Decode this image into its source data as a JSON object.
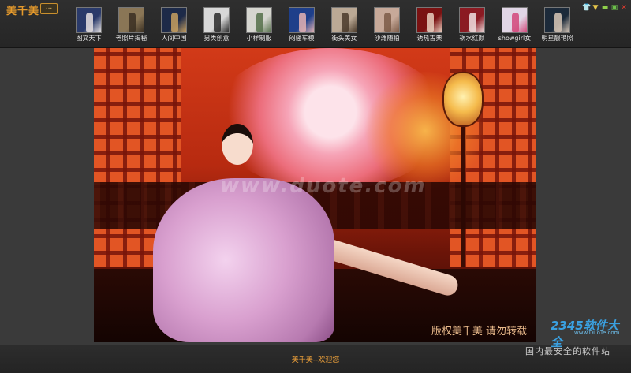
{
  "app": {
    "title": "美千美",
    "menu_label": "..."
  },
  "thumbnails": [
    {
      "label": "图文天下",
      "colors": [
        "#2a3a6a",
        "#e7e2e2"
      ]
    },
    {
      "label": "老照片揭秘",
      "colors": [
        "#8a7656",
        "#3a2f22"
      ]
    },
    {
      "label": "人间中国",
      "colors": [
        "#1d2a48",
        "#c8a060"
      ]
    },
    {
      "label": "另类创意",
      "colors": [
        "#d8d8d8",
        "#2a2a2a"
      ]
    },
    {
      "label": "小样制服",
      "colors": [
        "#d6d6d0",
        "#55704a"
      ]
    },
    {
      "label": "闷骚车模",
      "colors": [
        "#1e3f8a",
        "#e5b3b3"
      ]
    },
    {
      "label": "街头美女",
      "colors": [
        "#bba995",
        "#4a3a2a"
      ]
    },
    {
      "label": "沙滩随拍",
      "colors": [
        "#c7a999",
        "#7b5a46"
      ]
    },
    {
      "label": "诱热古典",
      "colors": [
        "#7a1212",
        "#e9d0c0"
      ]
    },
    {
      "label": "祸水红颜",
      "colors": [
        "#8b1a22",
        "#f0e0e0"
      ]
    },
    {
      "label": "showgirl女",
      "colors": [
        "#e1d6e6",
        "#d2477a"
      ]
    },
    {
      "label": "明星靓艳照",
      "colors": [
        "#1c2a3a",
        "#d8c8b8"
      ]
    }
  ],
  "window_controls": [
    {
      "name": "skin-icon",
      "glyph": "👕",
      "color": "#3aa7e6"
    },
    {
      "name": "dropdown-icon",
      "glyph": "▼",
      "color": "#e8c84a"
    },
    {
      "name": "minimize-icon",
      "glyph": "▬",
      "color": "#8fcf4a"
    },
    {
      "name": "maximize-icon",
      "glyph": "▣",
      "color": "#6cbf4a"
    },
    {
      "name": "close-icon",
      "glyph": "✕",
      "color": "#e23b2e"
    }
  ],
  "photo": {
    "watermark": "www.duote.com",
    "copyright": "版权美千美 请勿转载"
  },
  "footer": {
    "text": "美千美--欢迎您"
  },
  "brand": {
    "logo": "2345软件大全",
    "url": "www.DuoTe.com",
    "slogan": "国内最安全的软件站"
  }
}
